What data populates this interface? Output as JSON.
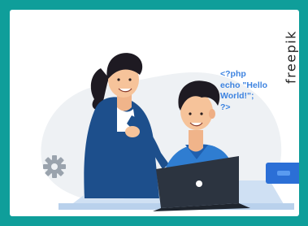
{
  "watermark": {
    "text": "freepik"
  },
  "code_snippet": {
    "lines": [
      "<?php",
      "echo \"Hello",
      "World!\";",
      "?>"
    ],
    "color": "#3d83e0"
  },
  "colors": {
    "frame": "#0f9e9a",
    "accent_blue": "#2b6fd6",
    "shirt_woman": "#1d4f8c",
    "shirt_man": "#2f7dd1",
    "laptop": "#2c3440"
  },
  "icons": [
    "gear-icon",
    "cloud-icon",
    "laptop-icon",
    "button-icon"
  ]
}
